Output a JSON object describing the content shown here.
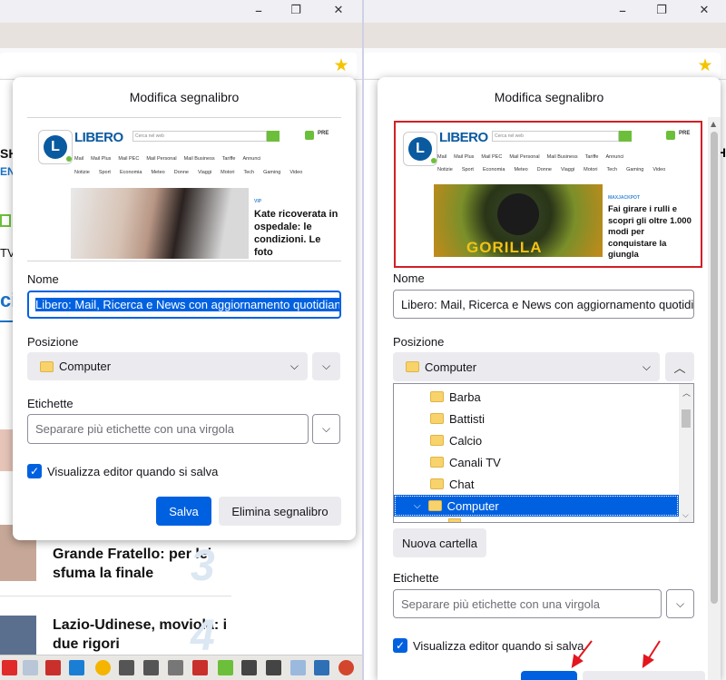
{
  "window": {
    "restore_glyph": "❐",
    "close_glyph": "✕"
  },
  "bookmark_star_glyph": "★",
  "dialog": {
    "title": "Modifica segnalibro",
    "name_label": "Nome",
    "name_value": "Libero: Mail, Ricerca e News con aggiornamento quotidiano",
    "position_label": "Posizione",
    "position_value": "Computer",
    "tags_label": "Etichette",
    "tags_placeholder": "Separare più etichette con una virgola",
    "show_editor_label": "Visualizza editor quando si salva",
    "save_label": "Salva",
    "delete_label": "Elimina segnalibro",
    "new_folder_label": "Nuova cartella"
  },
  "folders": [
    "Barba",
    "Battisti",
    "Calcio",
    "Canali TV",
    "Chat",
    "Computer"
  ],
  "thumbnail": {
    "logo_letter": "L",
    "brand": "LIBERO",
    "search_placeholder": "Cerca nel web",
    "pre": "PRE",
    "nav_top": [
      "Mail",
      "Mail Plus",
      "Mail PEC",
      "Mail Personal",
      "Mail Business",
      "Tariffe",
      "Annunci"
    ],
    "nav_bottom": [
      "Notizie",
      "Sport",
      "Economia",
      "Meteo",
      "Donne",
      "Viaggi",
      "Motori",
      "Tech",
      "Gaming",
      "Video"
    ],
    "left_tag": "VIP",
    "left_headline": "Kate ricoverata in ospedale: le condizioni. Le foto",
    "right_tag": "MAXJACKPOT",
    "right_headline": "Fai girare i rulli e scopri gli oltre 1.000 modi per conquistare la giungla",
    "right_banner": "GORILLA"
  },
  "background_page": {
    "snippet_sh": "SH",
    "snippet_en": "EN",
    "snippet_tv": "TV",
    "snippet_c": "ci",
    "headline1": "Grande Fratello: per lei sfuma la finale",
    "headline2": "Lazio-Udinese, moviola: i due rigori",
    "num3": "3",
    "num4": "4"
  },
  "colors": {
    "accent": "#0061e0",
    "highlight_border": "#d21f26",
    "arrow": "#e3161f"
  }
}
